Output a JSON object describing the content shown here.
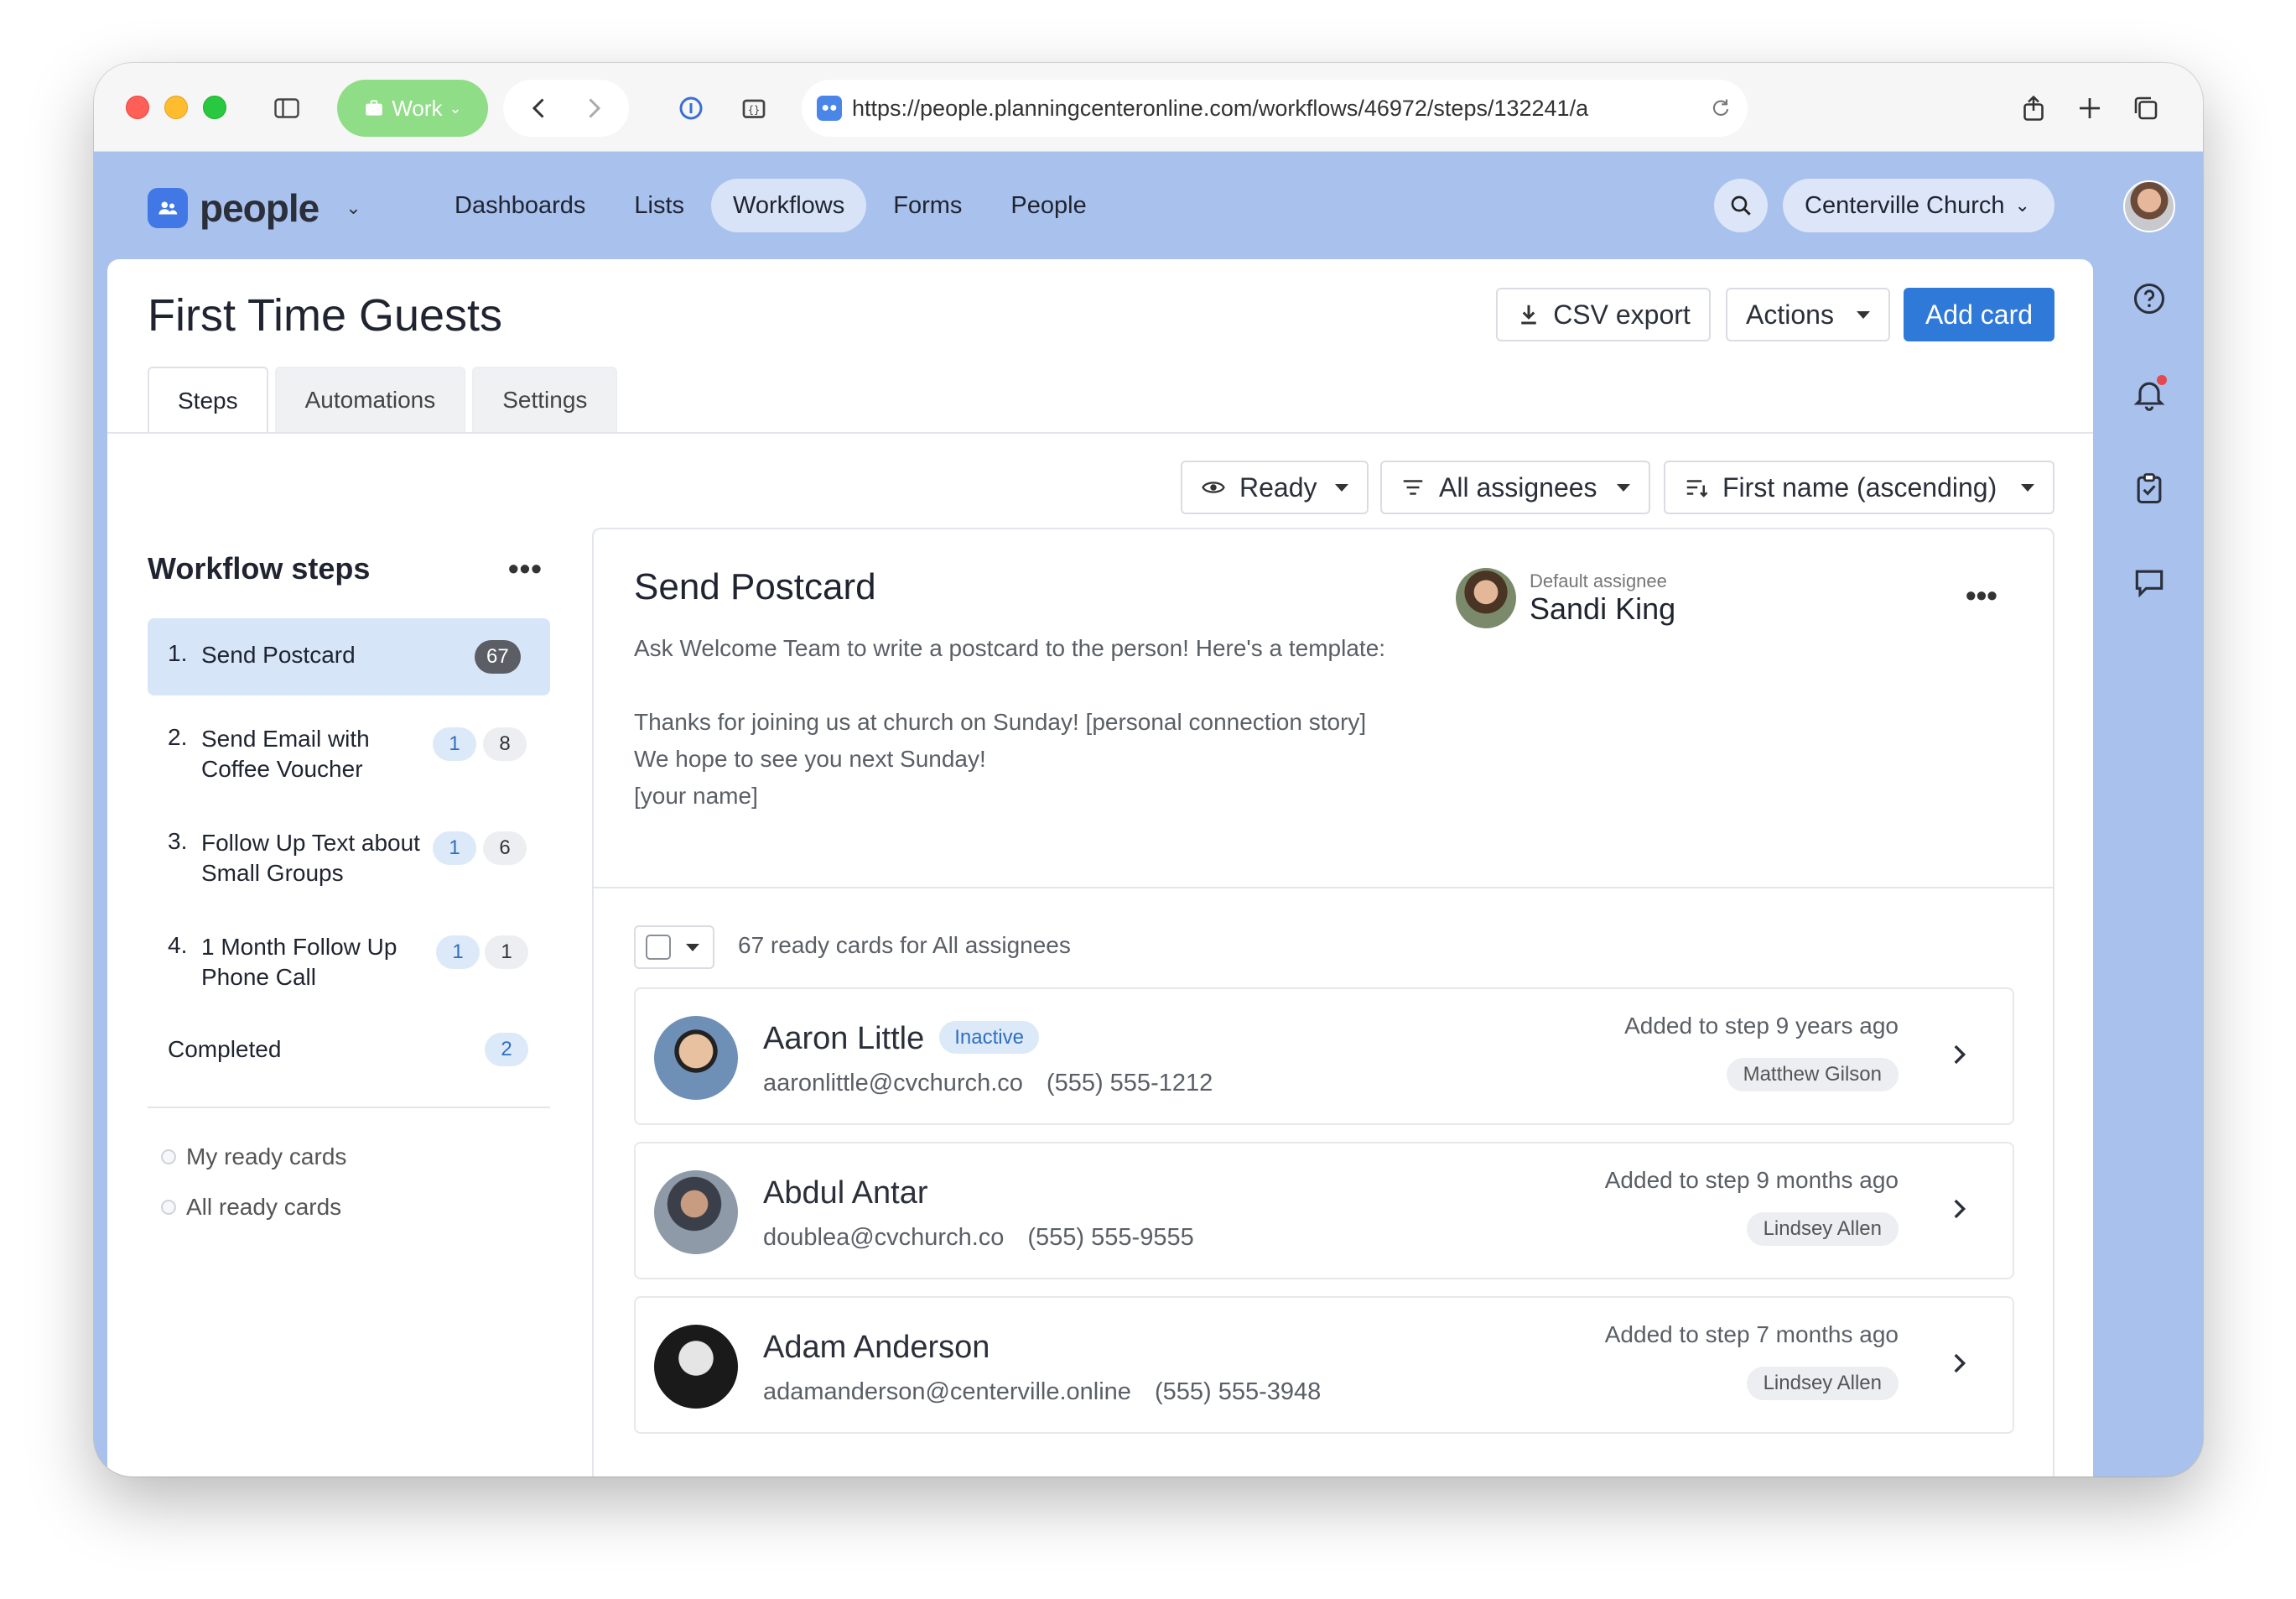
{
  "browser": {
    "workspace_label": "Work",
    "url": "https://people.planningcenteronline.com/workflows/46972/steps/132241/a"
  },
  "app": {
    "logo_text": "people",
    "nav": [
      "Dashboards",
      "Lists",
      "Workflows",
      "Forms",
      "People"
    ],
    "active_nav": "Workflows",
    "org_name": "Centerville Church"
  },
  "page": {
    "title": "First Time Guests",
    "csv_label": "CSV export",
    "actions_label": "Actions",
    "add_label": "Add card",
    "tabs": [
      "Steps",
      "Automations",
      "Settings"
    ],
    "active_tab": "Steps"
  },
  "filters": {
    "status": "Ready",
    "assignees": "All assignees",
    "sort": "First name (ascending)"
  },
  "steps": {
    "heading": "Workflow steps",
    "more": "•••",
    "items": [
      {
        "num": "1.",
        "label": "Send Postcard",
        "badges": [
          "67"
        ]
      },
      {
        "num": "2.",
        "label": "Send Email with Coffee Voucher",
        "badges": [
          "1",
          "8"
        ]
      },
      {
        "num": "3.",
        "label": "Follow Up Text about Small Groups",
        "badges": [
          "1",
          "6"
        ]
      },
      {
        "num": "4.",
        "label": "1 Month Follow Up Phone Call",
        "badges": [
          "1",
          "1"
        ]
      }
    ],
    "completed_label": "Completed",
    "completed_count": "2",
    "filters": [
      "My ready cards",
      "All ready cards"
    ]
  },
  "detail": {
    "title": "Send Postcard",
    "assignee_label": "Default assignee",
    "assignee_name": "Sandi King",
    "more": "•••",
    "description": [
      "Ask Welcome Team to write a postcard to the person! Here's a template:",
      "Thanks for joining us at church on Sunday! [personal connection story]",
      "We hope to see you next Sunday!",
      "[your name]"
    ],
    "count_text": "67 ready cards for All assignees"
  },
  "cards": [
    {
      "name": "Aaron Little",
      "status": "Inactive",
      "email": "aaronlittle@cvchurch.co",
      "phone": "(555) 555-1212",
      "added": "Added to step 9 years ago",
      "owner": "Matthew Gilson"
    },
    {
      "name": "Abdul Antar",
      "status": "",
      "email": "doublea@cvchurch.co",
      "phone": "(555) 555-9555",
      "added": "Added to step 9 months ago",
      "owner": "Lindsey Allen"
    },
    {
      "name": "Adam Anderson",
      "status": "",
      "email": "adamanderson@centerville.online",
      "phone": "(555) 555-3948",
      "added": "Added to step 7 months ago",
      "owner": "Lindsey Allen"
    }
  ]
}
